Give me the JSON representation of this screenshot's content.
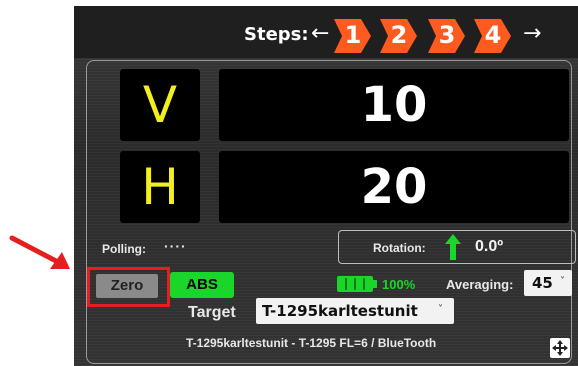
{
  "steps": {
    "label": "Steps:",
    "arrow_left": "←",
    "arrow_right": "→",
    "items": [
      "1",
      "2",
      "3",
      "4"
    ],
    "active_index": 1,
    "color": "#ff5a1f"
  },
  "readings": {
    "v_label": "V",
    "v_value": "10",
    "h_label": "H",
    "h_value": "20",
    "letter_color": "#f2ef1e"
  },
  "status": {
    "polling_label": "Polling:",
    "polling_value": "····",
    "rotation_label": "Rotation:",
    "rotation_value": "0.0º",
    "rotation_icon": "up-arrow-icon",
    "battery_percent": "100%",
    "battery_level": 1.0
  },
  "controls": {
    "zero_label": "Zero",
    "abs_label": "ABS",
    "averaging_label": "Averaging:",
    "averaging_value": "45",
    "target_label": "Target",
    "target_value": "T-1295karltestunit",
    "device_info": "T-1295karltestunit - T-1295 FL=6 / BlueTooth"
  },
  "colors": {
    "highlight": "#e51f1f",
    "abs_green": "#1bd62a",
    "battery_green": "#1bd62a"
  }
}
